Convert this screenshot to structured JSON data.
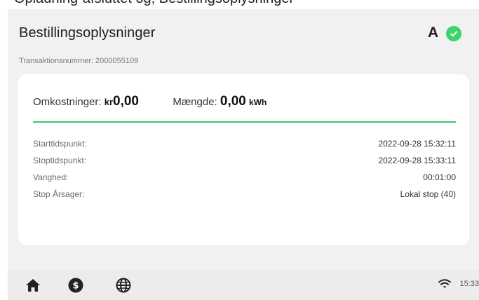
{
  "top_strip": {
    "text": "Opladning-afsluttet og, Bestillingsoplysninger"
  },
  "header": {
    "title": "Bestillingsoplysninger",
    "transaction_label": "Transaktionsnummer: 2000055109",
    "grade": "A"
  },
  "summary": {
    "cost_label": "Omkostninger:",
    "cost_currency": "kr",
    "cost_value": "0,00",
    "quantity_label": "Mængde:",
    "quantity_value": "0,00",
    "quantity_unit": "kWh"
  },
  "details": [
    {
      "label": "Starttidspunkt:",
      "value": "2022-09-28 15:32:11"
    },
    {
      "label": "Stoptidspunkt:",
      "value": "2022-09-28 15:33:11"
    },
    {
      "label": "Varighed:",
      "value": "00:01:00"
    },
    {
      "label": "Stop Årsager:",
      "value": "Lokal stop (40)"
    }
  ],
  "status_bar": {
    "time": "15:33"
  },
  "nav": {
    "home_icon": "home-icon",
    "dollar_icon": "dollar-icon",
    "globe_icon": "globe-icon",
    "wifi_icon": "wifi-icon"
  },
  "colors": {
    "accent_green": "#3ed46b",
    "divider_green": "#3cc66a",
    "panel_bg": "#f1f1f1",
    "bottom_bar_bg": "#ececec"
  }
}
